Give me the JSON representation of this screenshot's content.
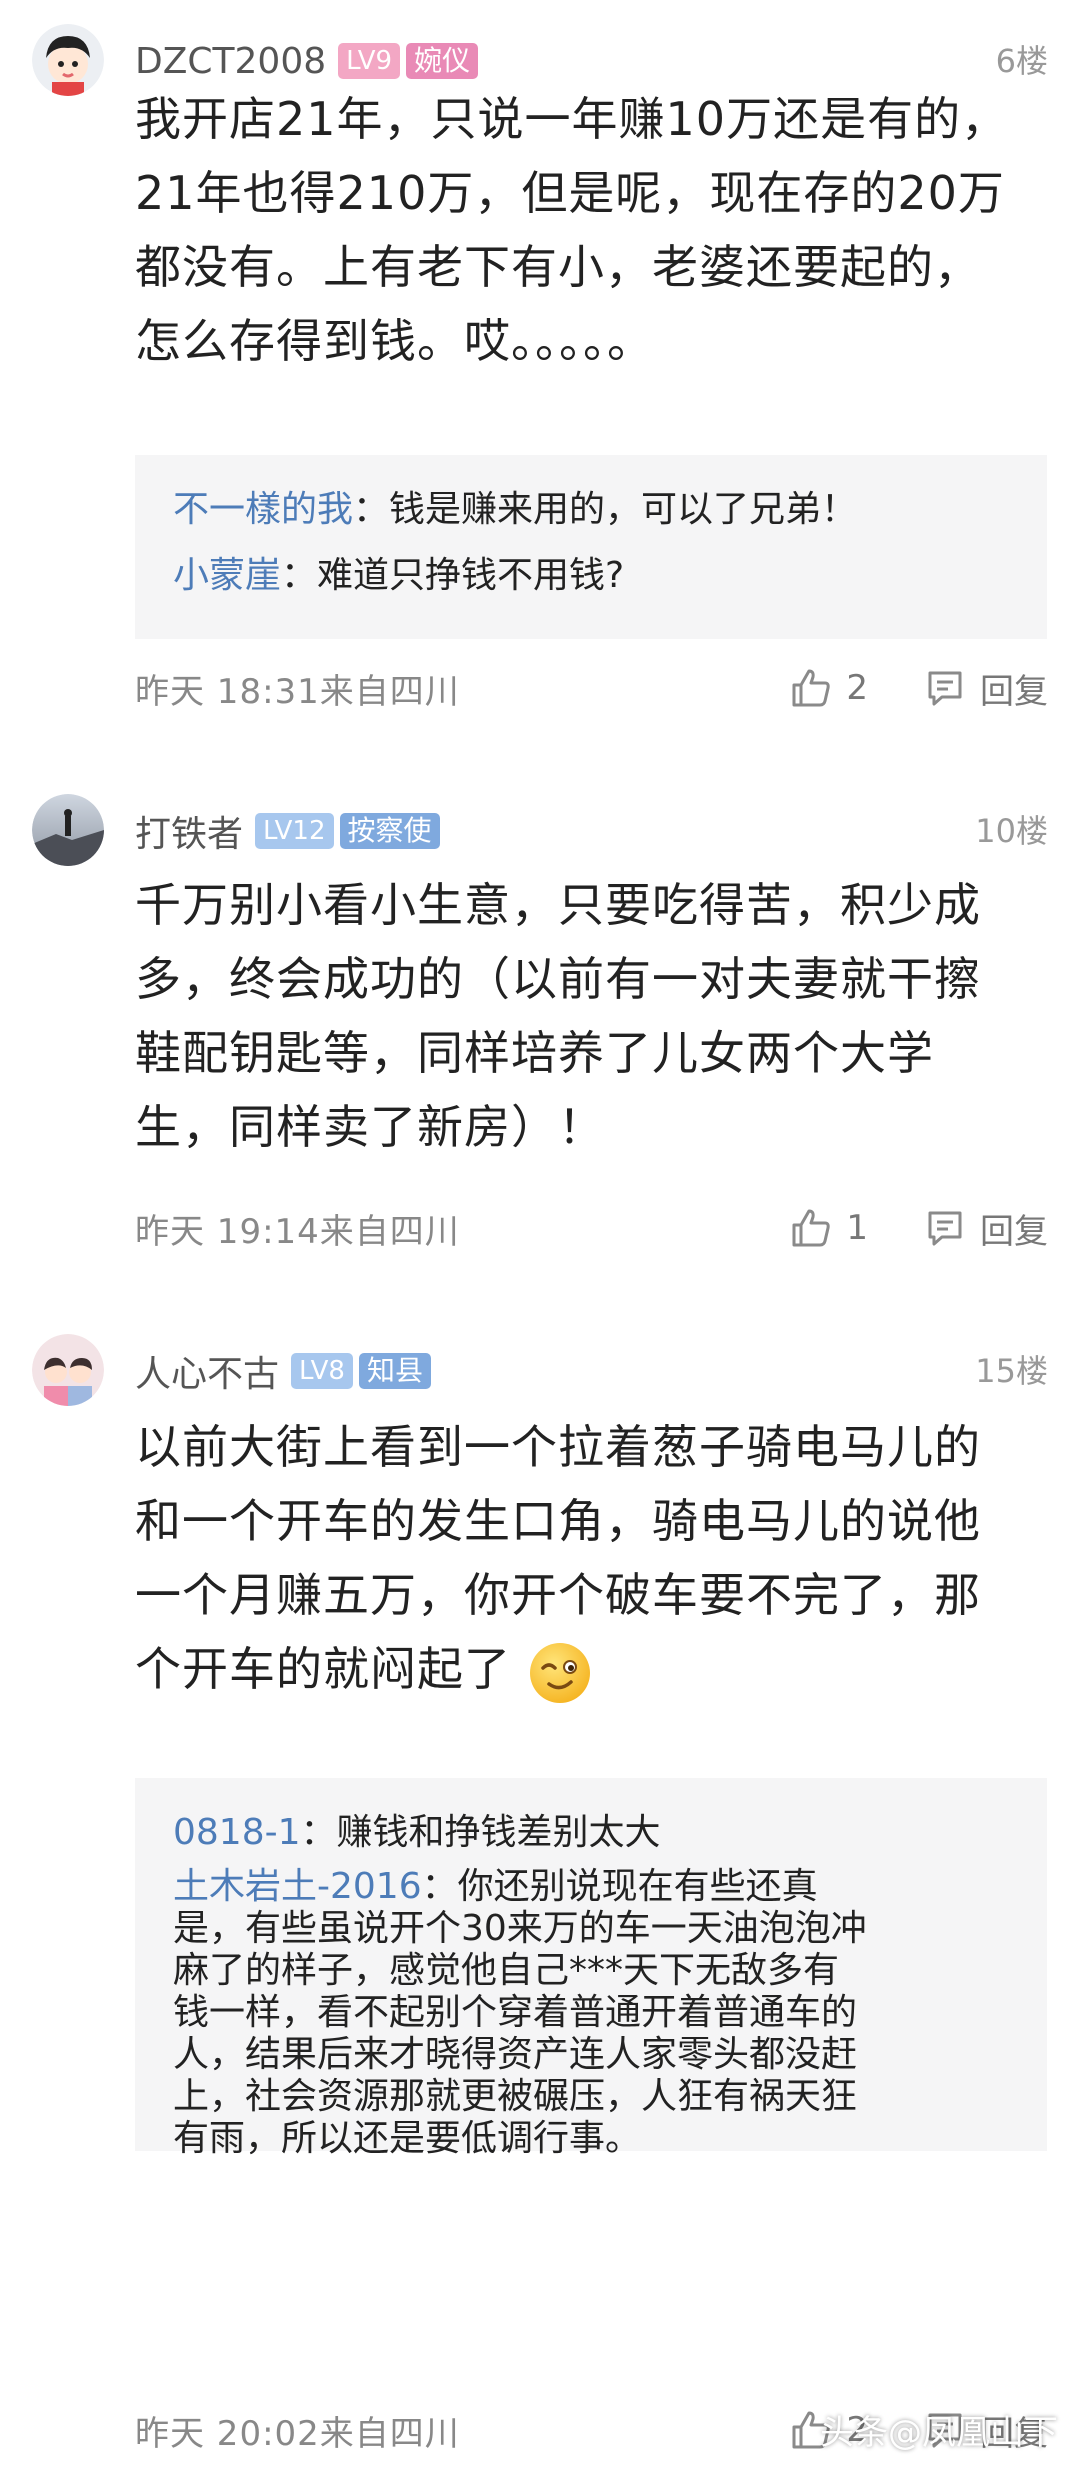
{
  "comments": [
    {
      "username": "DZCT2008",
      "level": "LV9",
      "title": "婉仪",
      "level_color": "#f3a7c4",
      "title_color": "#e98ab6",
      "floor": "6楼",
      "text_lines": [
        "我开店21年，只说一年赚10万还是有的，",
        "21年也得210万，但是呢，现在存的20万",
        "都没有。上有老下有小，老婆还要起的，",
        "怎么存得到钱。哎。。。。。"
      ],
      "replies": [
        {
          "name": "不一樣的我",
          "sep": "：",
          "text": "钱是赚来用的，可以了兄弟！"
        },
        {
          "name": "小蒙崖",
          "sep": "：",
          "text": "难道只挣钱不用钱?"
        }
      ],
      "timestamp": "昨天 18:31来自四川",
      "likes": "2",
      "reply_label": "回复"
    },
    {
      "username": "打铁者",
      "level": "LV12",
      "title": "按察使",
      "level_color": "#a7c7ee",
      "title_color": "#7fa9de",
      "floor": "10楼",
      "text_lines": [
        "千万别小看小生意，只要吃得苦，积少成",
        "多，终会成功的（以前有一对夫妻就干擦",
        "鞋配钥匙等，同样培养了儿女两个大学",
        "生，同样卖了新房）！"
      ],
      "timestamp": "昨天 19:14来自四川",
      "likes": "1",
      "reply_label": "回复"
    },
    {
      "username": "人心不古",
      "level": "LV8",
      "title": "知县",
      "level_color": "#a7c7ee",
      "title_color": "#7fa9de",
      "floor": "15楼",
      "text_lines": [
        "以前大街上看到一个拉着葱子骑电马儿的",
        "和一个开车的发生口角，骑电马儿的说他",
        "一个月赚五万，你开个破车要不完了，那",
        "个开车的就闷起了"
      ],
      "replies": [
        {
          "name": "0818-1",
          "sep": "：",
          "text": "赚钱和挣钱差别太大"
        },
        {
          "name": "土木岩土-2016",
          "sep": "：",
          "text": "你还别说现在有些还真"
        }
      ],
      "reply_continuation": [
        "是，有些虽说开个30来万的车一天油泡泡冲",
        "麻了的样子，感觉他自己***天下无敌多有",
        "钱一样，看不起别个穿着普通开着普通车的",
        "人，结果后来才晓得资产连人家零头都没赶",
        "上，社会资源那就更被碾压，人狂有祸天狂",
        "有雨，所以还是要低调行事。"
      ],
      "timestamp": "昨天 20:02来自四川",
      "likes": "2",
      "reply_label": "回复"
    }
  ],
  "watermark": {
    "platform": "头条",
    "handle": "@凤凰山下"
  },
  "colors": {
    "reply_name": "#4d7cb8",
    "reply_bg": "#f5f5f6",
    "meta_text": "#888888"
  }
}
